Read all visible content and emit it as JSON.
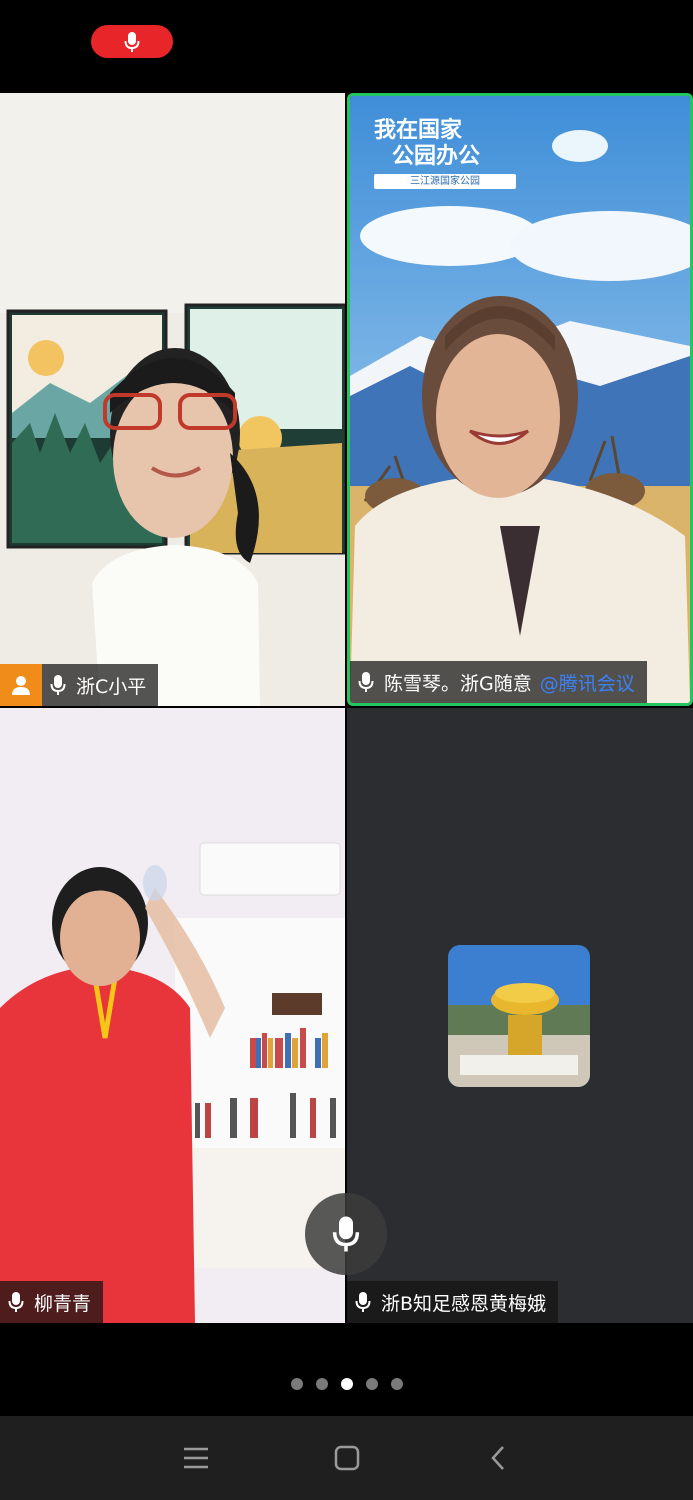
{
  "status": {
    "recording_indicator": "mic-on-icon",
    "accent": "#e8262a"
  },
  "participants": [
    {
      "name": "浙C小平",
      "is_host": true,
      "mic": "mic-icon"
    },
    {
      "name": "陈雪琴。浙G随意",
      "brand_tag": "@腾讯会议",
      "active_speaker": true,
      "mic": "mic-icon"
    },
    {
      "name": "柳青青",
      "mic": "mic-icon"
    },
    {
      "name": "浙B知足感恩黄梅娥",
      "video_off": true,
      "mic": "mic-icon"
    }
  ],
  "background_banner": {
    "title_line1": "我在国家",
    "title_line2": "公园办公",
    "subtitle": "三江源国家公园"
  },
  "pager": {
    "total": 5,
    "active_index": 2
  },
  "system_nav": {
    "recents": "recents-icon",
    "home": "home-icon",
    "back": "back-icon"
  },
  "colors": {
    "active_border": "#22c55e",
    "host_badge": "#f08c1a",
    "brand_link": "#3b82f6"
  }
}
